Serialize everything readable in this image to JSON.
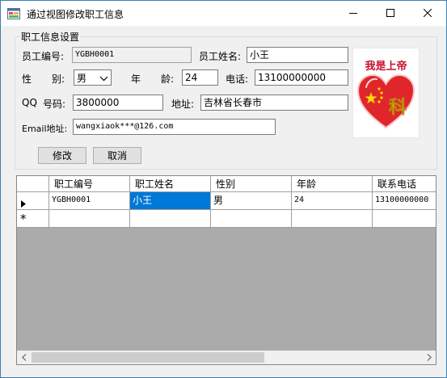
{
  "window": {
    "title": "通过视图修改职工信息"
  },
  "form": {
    "group_title": "职工信息设置",
    "emp_id_label": "员工编号:",
    "emp_id_value": "YGBH0001",
    "emp_name_label": "员工姓名:",
    "emp_name_value": "小王",
    "gender_label_1": "性",
    "gender_label_2": "别:",
    "gender_value": "男",
    "age_label_1": "年",
    "age_label_2": "龄:",
    "age_value": "24",
    "phone_label": "电话:",
    "phone_value": "13100000000",
    "qq_label_1": "QQ",
    "qq_label_2": "号码:",
    "qq_value": "3800000",
    "address_label": "地址:",
    "address_value": "吉林省长春市",
    "email_label": "Email地址:",
    "email_value": "wangxiaok***@126.com",
    "modify_button": "修改",
    "cancel_button": "取消"
  },
  "picture": {
    "banner_text": "我是上帝",
    "heart_text": "科"
  },
  "grid": {
    "columns": [
      "职工编号",
      "职工姓名",
      "性别",
      "年龄",
      "联系电话"
    ],
    "rows": [
      [
        "YGBH0001",
        "小王",
        "男",
        "24",
        "13100000000"
      ]
    ],
    "selected_cell": {
      "row": 0,
      "column": 1
    },
    "new_row_marker": "*"
  },
  "colors": {
    "selection": "#0078d7",
    "window_border": "#3c7fb1",
    "grid_background": "#ababab"
  },
  "icons": {
    "app": "app-form-icon",
    "minimize": "minimize-icon",
    "maximize": "maximize-icon",
    "close": "close-icon",
    "current_row": "current-row-arrow-icon",
    "new_row": "new-row-asterisk-icon"
  }
}
